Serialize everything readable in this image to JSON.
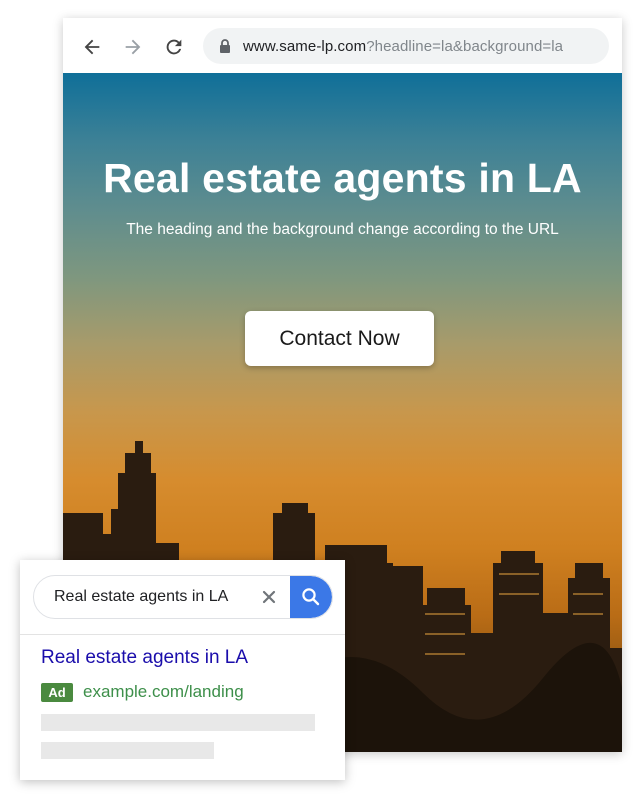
{
  "browser": {
    "url_domain": "www.same-lp.com",
    "url_query": "?headline=la&background=la",
    "icons": {
      "back": "back-arrow-icon",
      "forward": "forward-arrow-icon",
      "reload": "reload-icon",
      "lock": "lock-icon"
    }
  },
  "hero": {
    "title": "Real estate agents in LA",
    "subtitle": "The heading and the background change according to the URL",
    "cta_label": "Contact Now"
  },
  "search": {
    "query": "Real estate agents in LA",
    "icons": {
      "clear": "close-icon",
      "search": "search-icon"
    }
  },
  "result": {
    "title": "Real estate agents in LA",
    "badge": "Ad",
    "url": "example.com/landing"
  },
  "colors": {
    "link_blue": "#1a0dab",
    "ad_green": "#4a8a3f",
    "url_green": "#3d8f4a",
    "search_button_blue": "#3b78e7"
  }
}
